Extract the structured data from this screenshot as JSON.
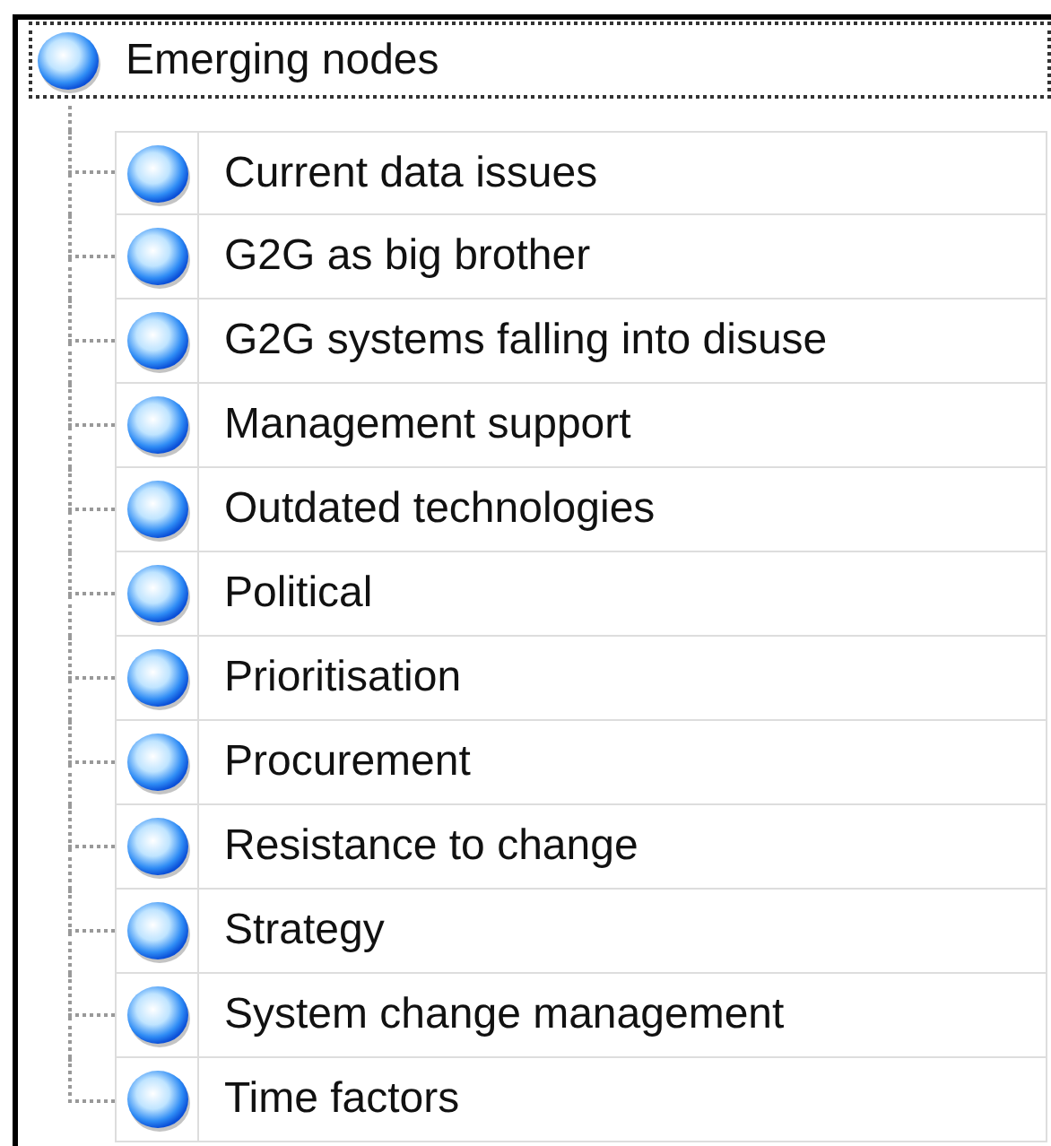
{
  "tree": {
    "label": "Emerging nodes",
    "focused": true,
    "children": [
      {
        "label": "Current data issues"
      },
      {
        "label": "G2G as big brother"
      },
      {
        "label": "G2G systems falling into disuse"
      },
      {
        "label": "Management support"
      },
      {
        "label": "Outdated technologies"
      },
      {
        "label": "Political"
      },
      {
        "label": "Prioritisation"
      },
      {
        "label": "Procurement"
      },
      {
        "label": "Resistance to change"
      },
      {
        "label": "Strategy"
      },
      {
        "label": "System change management"
      },
      {
        "label": "Time factors"
      }
    ]
  }
}
